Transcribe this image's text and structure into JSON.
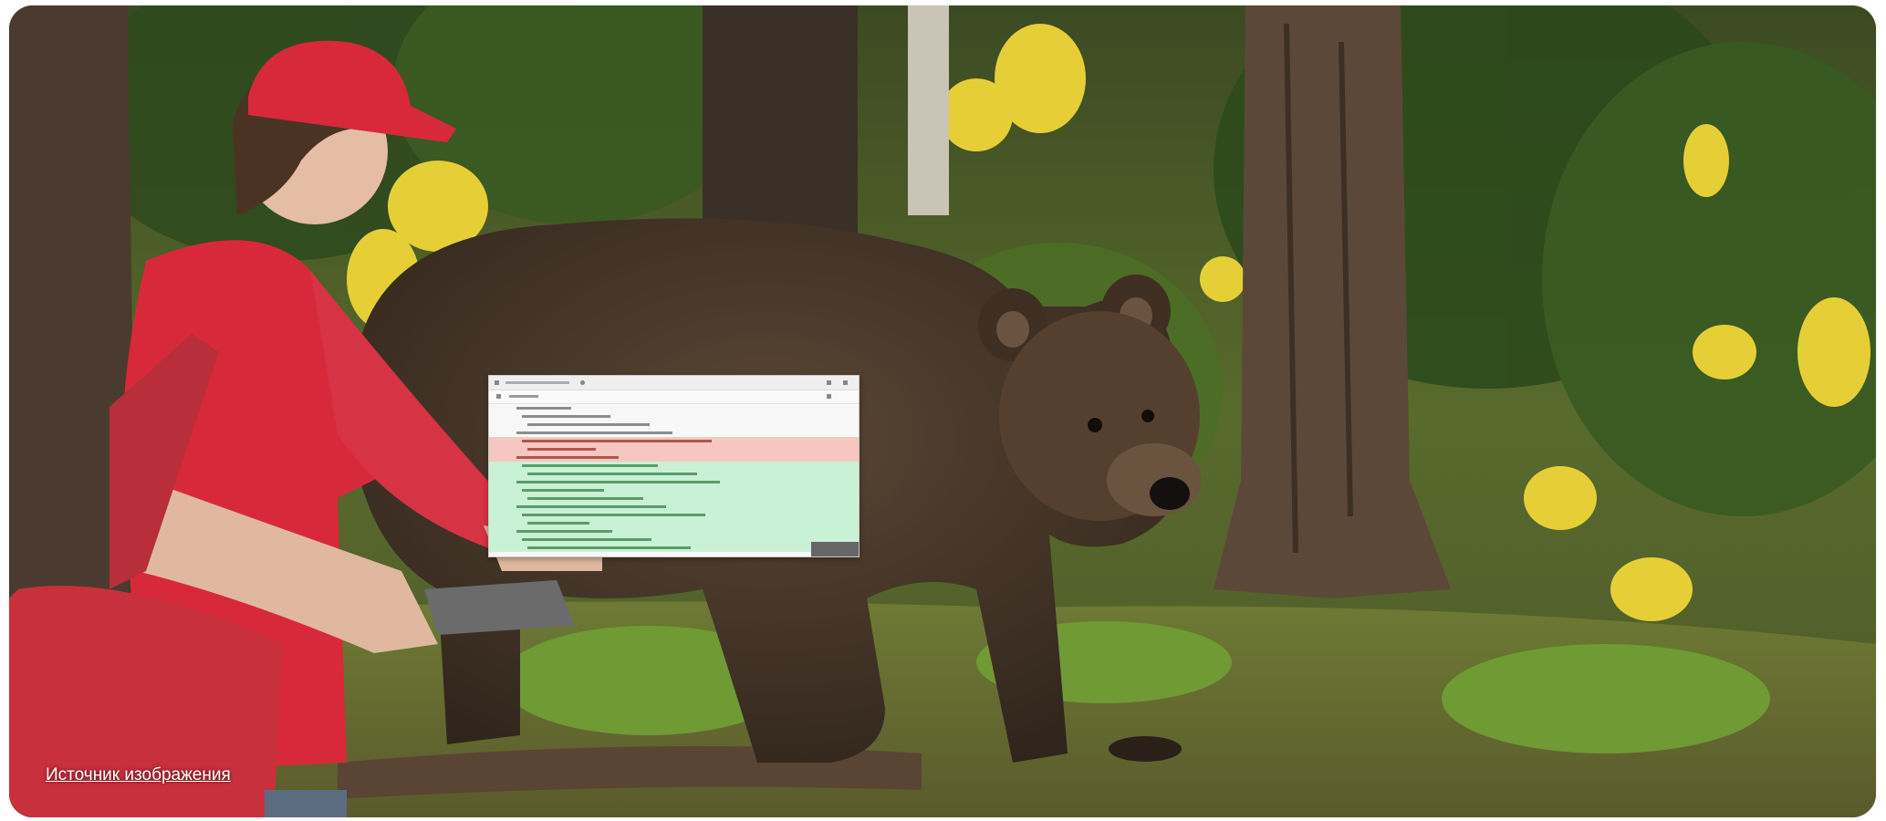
{
  "photo": {
    "description_subjects": [
      "courier-in-red-uniform",
      "brown-bear",
      "forest"
    ],
    "colors": {
      "uniform": "#d8293a",
      "bag": "#c8303c",
      "bear": "#4a3a2c",
      "foliage": "#5a7a2a",
      "flowers": "#e8d23a",
      "trunk": "#5a4536",
      "ground": "#6a6a32"
    }
  },
  "code_panel": {
    "rows": [
      "normal",
      "normal",
      "normal",
      "normal",
      "del",
      "del",
      "del",
      "add",
      "add",
      "add",
      "add",
      "add",
      "add",
      "add",
      "add",
      "add",
      "add",
      "add"
    ]
  },
  "caption": {
    "source_link": "Источник изображения"
  }
}
